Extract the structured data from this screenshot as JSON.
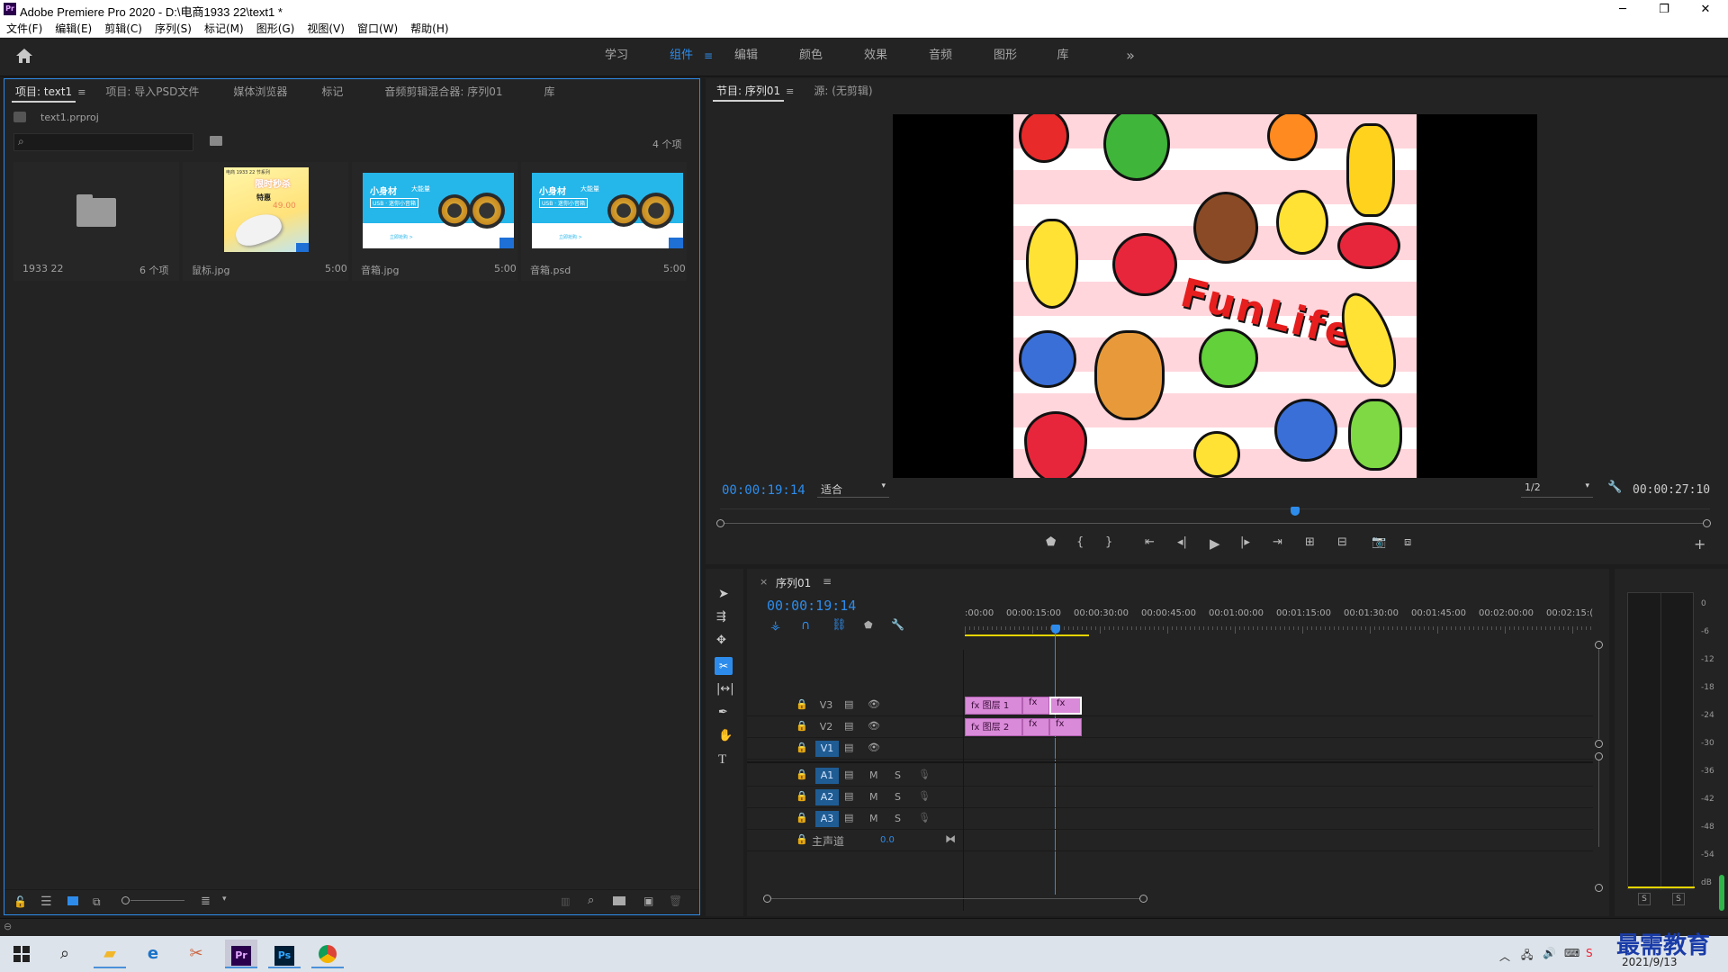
{
  "window": {
    "app_icon": "Pr",
    "title": "Adobe Premiere Pro 2020 - D:\\电商1933 22\\text1 *",
    "minimize": "─",
    "maximize": "❐",
    "close": "✕"
  },
  "menu": [
    "文件(F)",
    "编辑(E)",
    "剪辑(C)",
    "序列(S)",
    "标记(M)",
    "图形(G)",
    "视图(V)",
    "窗口(W)",
    "帮助(H)"
  ],
  "workspaces": {
    "items": [
      "学习",
      "组件",
      "编辑",
      "颜色",
      "效果",
      "音频",
      "图形",
      "库"
    ],
    "active": "组件",
    "more": "»"
  },
  "project_panel": {
    "tabs": [
      "项目: text1",
      "项目: 导入PSD文件",
      "媒体浏览器",
      "标记",
      "音频剪辑混合器: 序列01",
      "库"
    ],
    "project_file": "text1.prproj",
    "search_value": "",
    "item_count": "4 个项",
    "items": [
      {
        "name": "1933 22",
        "meta": "6 个项",
        "type": "folder"
      },
      {
        "name": "鼠标.jpg",
        "meta": "5:00",
        "type": "image"
      },
      {
        "name": "音箱.jpg",
        "meta": "5:00",
        "type": "image"
      },
      {
        "name": "音箱.psd",
        "meta": "5:00",
        "type": "image"
      }
    ],
    "thumb_text": {
      "mouse_header": "电商 1933 22 节系列",
      "mouse_title": "限时秒杀",
      "mouse_sub": "特惠",
      "mouse_price": "49.00",
      "speaker_title": "小身材",
      "speaker_title2": "大能量",
      "speaker_sub": "USB · 迷你小音箱",
      "speaker_btn": "立即抢购 >"
    }
  },
  "program_panel": {
    "tabs": [
      "节目: 序列01",
      "源: (无剪辑)"
    ],
    "timecode_current": "00:00:19:14",
    "fit": "适合",
    "resolution": "1/2",
    "timecode_duration": "00:00:27:10",
    "preview_text": "FunLife"
  },
  "timeline": {
    "sequence_name": "序列01",
    "timecode": "00:00:19:14",
    "ruler": [
      ":00:00",
      "00:00:15:00",
      "00:00:30:00",
      "00:00:45:00",
      "00:01:00:00",
      "00:01:15:00",
      "00:01:30:00",
      "00:01:45:00",
      "00:02:00:00",
      "00:02:15:("
    ],
    "video_tracks": [
      {
        "label": "V3",
        "clip1": "图层 1",
        "clip_badge": "fx"
      },
      {
        "label": "V2",
        "clip1": "图层 2",
        "clip_badge": "fx"
      },
      {
        "label": "V1",
        "clip1": "",
        "clip_badge": ""
      }
    ],
    "audio_tracks": [
      {
        "label": "A1",
        "m": "M",
        "s": "S"
      },
      {
        "label": "A2",
        "m": "M",
        "s": "S"
      },
      {
        "label": "A3",
        "m": "M",
        "s": "S"
      }
    ],
    "master_label": "主声道",
    "master_value": "0.0"
  },
  "meter": {
    "scale": [
      "0",
      "-6",
      "-12",
      "-18",
      "-24",
      "-30",
      "-36",
      "-42",
      "-48",
      "-54",
      "dB"
    ],
    "solo_left": "S",
    "solo_right": "S"
  },
  "taskbar": {
    "date": "2021/9/13",
    "watermark": "最需教育"
  },
  "colors": {
    "accent": "#2d8ceb",
    "clip": "#d98ad8",
    "panel": "#232323",
    "background": "#1d1d1d"
  }
}
